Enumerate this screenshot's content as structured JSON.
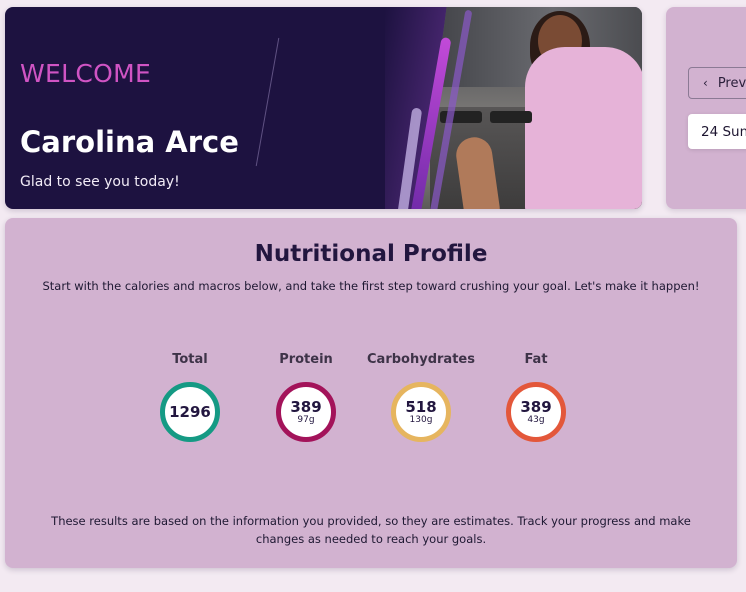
{
  "welcome": {
    "label": "WELCOME",
    "name": "Carolina Arce",
    "greeting": "Glad to see you today!"
  },
  "side_panel": {
    "prev_label": "Prev",
    "date": "24 Sun"
  },
  "nutrition": {
    "title": "Nutritional Profile",
    "subtitle": "Start with the calories and macros below, and take the first step toward crushing your goal. Let's make it happen!",
    "macros": [
      {
        "label": "Total",
        "value": "1296",
        "grams": "",
        "color": "#159a84"
      },
      {
        "label": "Protein",
        "value": "389",
        "grams": "97g",
        "color": "#a3135a"
      },
      {
        "label": "Carbohydrates",
        "value": "518",
        "grams": "130g",
        "color": "#e6b55f"
      },
      {
        "label": "Fat",
        "value": "389",
        "grams": "43g",
        "color": "#e3573a"
      }
    ],
    "footer": "These results are based on the information you provided, so they are estimates. Track your progress and make changes as needed to reach your goals."
  }
}
